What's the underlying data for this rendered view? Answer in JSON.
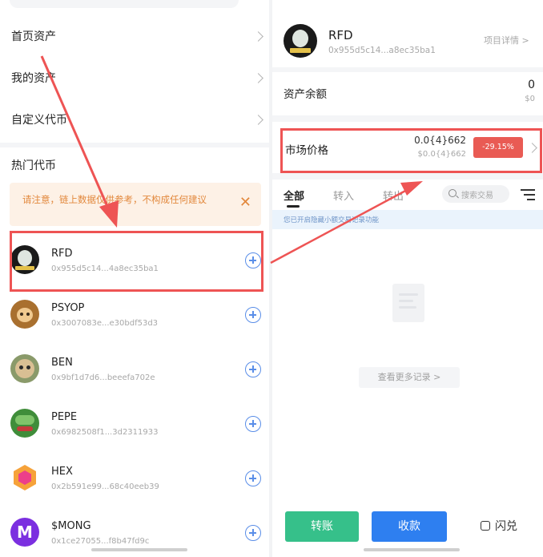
{
  "left": {
    "menu": [
      {
        "label": "首页资产"
      },
      {
        "label": "我的资产"
      },
      {
        "label": "自定义代币"
      }
    ],
    "section_title": "热门代币",
    "notice": {
      "text": "请注意，链上数据仅供参考，不构成任何建议",
      "close": "✕"
    },
    "tokens": [
      {
        "name": "RFD",
        "address": "0x955d5c14...4a8ec35ba1",
        "color": "#1a1a1a",
        "accent": "#9fb5a8"
      },
      {
        "name": "PSYOP",
        "address": "0x3007083e...e30bdf53d3",
        "color": "#a9702f",
        "accent": "#f0c98f"
      },
      {
        "name": "BEN",
        "address": "0x9bf1d7d6...beeefa702e",
        "color": "#b69a72",
        "accent": "#e8d3b4"
      },
      {
        "name": "PEPE",
        "address": "0x6982508f1...3d2311933",
        "color": "#3f8d3a",
        "accent": "#c43b3b"
      },
      {
        "name": "HEX",
        "address": "0x2b591e99...68c40eeb39",
        "color": "#f6a23a",
        "accent": "#ec3f8a"
      },
      {
        "name": "$MONG",
        "address": "0x1ce27055...f8b47fd9c",
        "color": "#7b2fe0",
        "accent": "#ffffff"
      }
    ]
  },
  "right": {
    "token": {
      "name": "RFD",
      "address": "0x955d5c14...a8ec35ba1",
      "link": "项目详情 >"
    },
    "balance": {
      "label": "资产余额",
      "value": "0",
      "sub": "$0"
    },
    "market": {
      "label": "市场价格",
      "value": "0.0{4}662",
      "sub": "$0.0{4}662",
      "change": "-29.15%"
    },
    "tabs": [
      {
        "label": "全部",
        "active": true
      },
      {
        "label": "转入",
        "active": false
      },
      {
        "label": "转出",
        "active": false
      }
    ],
    "search_placeholder": "搜索交易",
    "info": "您已开启隐藏小额交易记录功能",
    "more": "查看更多记录 >",
    "buttons": {
      "transfer": "转账",
      "receive": "收款",
      "flash": "闪兑"
    }
  },
  "colors": {
    "highlight": "#ee5454",
    "green": "#36c08a",
    "blue": "#2e7ff0",
    "badge": "#e95b54",
    "plus": "#5a8ee8"
  }
}
